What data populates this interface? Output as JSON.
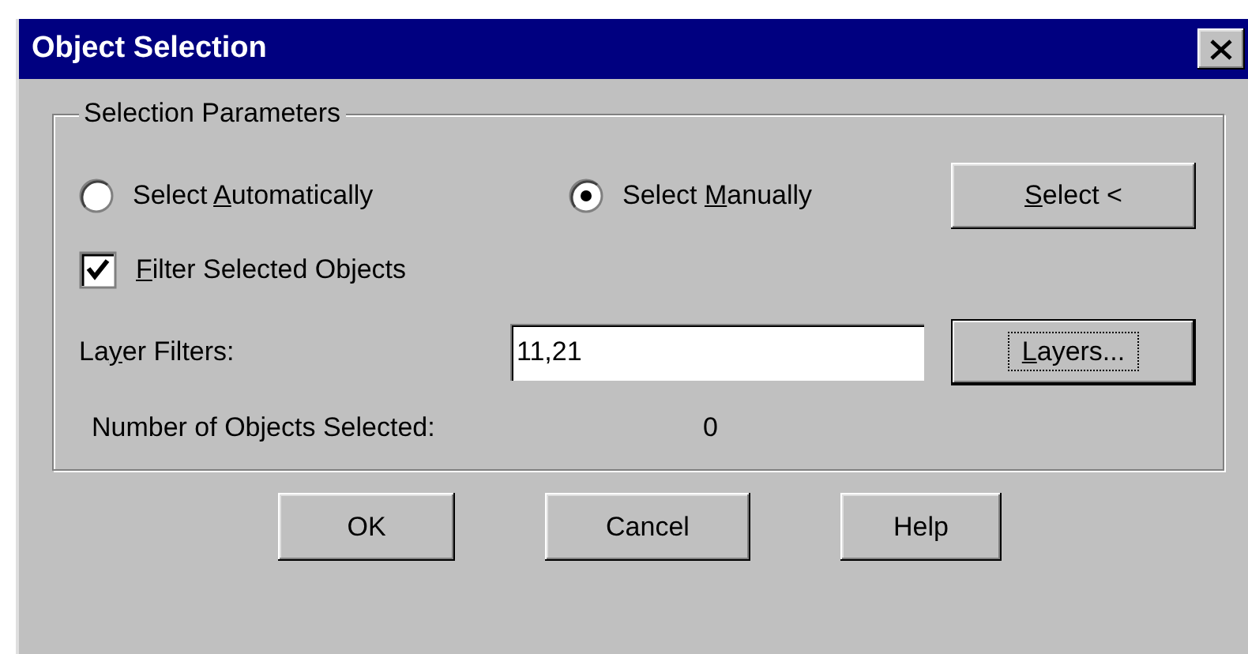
{
  "window": {
    "title": "Object Selection"
  },
  "group": {
    "title": "Selection Parameters",
    "mode_options": [
      {
        "label": {
          "before": "Select ",
          "key": "A",
          "after": "utomatically"
        },
        "selected": false
      },
      {
        "label": {
          "before": "Select ",
          "key": "M",
          "after": "anually"
        },
        "selected": true
      }
    ],
    "select_button": {
      "label": {
        "key": "S",
        "after": "elect <"
      }
    },
    "filter_checkbox": {
      "label": {
        "key": "F",
        "after": "ilter Selected Objects"
      },
      "checked": true
    },
    "layer_filters": {
      "label": {
        "before": "La",
        "key": "y",
        "after": "er Filters:"
      },
      "value": "11,21"
    },
    "layers_button": {
      "label": {
        "key": "L",
        "after": "ayers..."
      },
      "focused": true
    },
    "objects_selected": {
      "label": "Number of Objects Selected:",
      "value": "0"
    }
  },
  "buttons": [
    "OK",
    "Cancel",
    "Help"
  ]
}
